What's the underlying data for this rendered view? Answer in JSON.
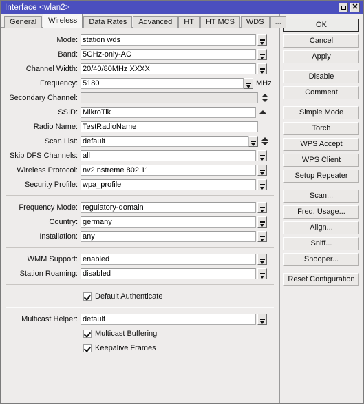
{
  "window": {
    "title": "Interface <wlan2>",
    "controls": [
      {
        "name": "maximize",
        "glyph": "square"
      },
      {
        "name": "close",
        "glyph": "x"
      }
    ],
    "accent_color": "#4b4fbe",
    "background_color": "#eeeceb"
  },
  "tabs": [
    {
      "label": "General",
      "active": false
    },
    {
      "label": "Wireless",
      "active": true
    },
    {
      "label": "Data Rates",
      "active": false
    },
    {
      "label": "Advanced",
      "active": false
    },
    {
      "label": "HT",
      "active": false
    },
    {
      "label": "HT MCS",
      "active": false
    },
    {
      "label": "WDS",
      "active": false
    },
    {
      "label": "...",
      "active": false
    }
  ],
  "form": {
    "mode": {
      "label": "Mode:",
      "value": "station wds"
    },
    "band": {
      "label": "Band:",
      "value": "5GHz-only-AC"
    },
    "channel_width": {
      "label": "Channel Width:",
      "value": "20/40/80MHz XXXX"
    },
    "frequency": {
      "label": "Frequency:",
      "value": "5180",
      "unit": "MHz"
    },
    "secondary_channel": {
      "label": "Secondary Channel:",
      "value": ""
    },
    "ssid": {
      "label": "SSID:",
      "value": "MikroTik"
    },
    "radio_name": {
      "label": "Radio Name:",
      "value": "TestRadioName"
    },
    "scan_list": {
      "label": "Scan List:",
      "value": "default"
    },
    "skip_dfs_channels": {
      "label": "Skip DFS Channels:",
      "value": "all"
    },
    "wireless_protocol": {
      "label": "Wireless Protocol:",
      "value": "nv2 nstreme 802.11"
    },
    "security_profile": {
      "label": "Security Profile:",
      "value": "wpa_profile"
    },
    "frequency_mode": {
      "label": "Frequency Mode:",
      "value": "regulatory-domain"
    },
    "country": {
      "label": "Country:",
      "value": "germany"
    },
    "installation": {
      "label": "Installation:",
      "value": "any"
    },
    "wmm_support": {
      "label": "WMM Support:",
      "value": "enabled"
    },
    "station_roaming": {
      "label": "Station Roaming:",
      "value": "disabled"
    },
    "default_authenticate": {
      "label": "Default Authenticate",
      "checked": true
    },
    "multicast_helper": {
      "label": "Multicast Helper:",
      "value": "default"
    },
    "multicast_buffering": {
      "label": "Multicast Buffering",
      "checked": true
    },
    "keepalive_frames": {
      "label": "Keepalive Frames",
      "checked": true
    }
  },
  "buttons": {
    "ok": "OK",
    "cancel": "Cancel",
    "apply": "Apply",
    "disable": "Disable",
    "comment": "Comment",
    "simple_mode": "Simple Mode",
    "torch": "Torch",
    "wps_accept": "WPS Accept",
    "wps_client": "WPS Client",
    "setup_repeater": "Setup Repeater",
    "scan": "Scan...",
    "freq_usage": "Freq. Usage...",
    "align": "Align...",
    "sniff": "Sniff...",
    "snooper": "Snooper...",
    "reset_configuration": "Reset Configuration"
  }
}
